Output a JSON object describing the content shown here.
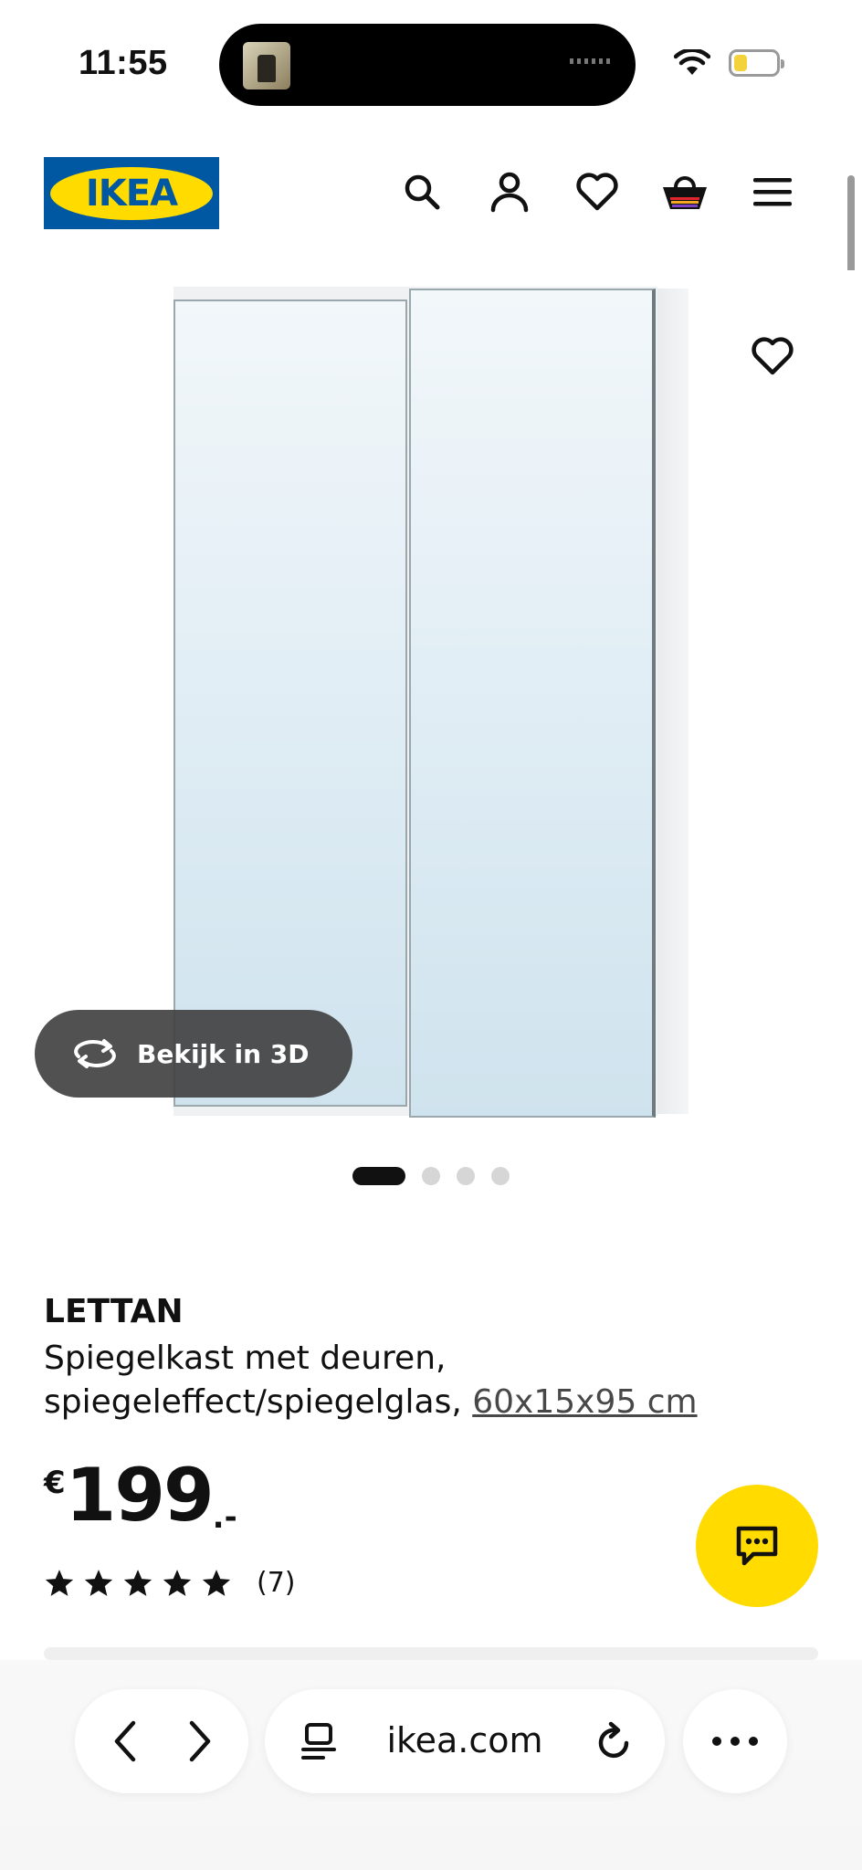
{
  "status_bar": {
    "time": "11:55"
  },
  "header": {
    "logo_text": "IKEA",
    "icons": [
      "search-icon",
      "user-icon",
      "heart-icon",
      "basket-icon",
      "menu-icon"
    ]
  },
  "gallery": {
    "view_3d_label": "Bekijk in 3D",
    "image_count": 4,
    "active_index": 0
  },
  "product": {
    "name": "LETTAN",
    "description": "Spiegelkast met deuren, spiegeleffect/spiegelglas,",
    "size": "60x15x95 cm",
    "price_currency": "€",
    "price_value": "199",
    "price_decimals": ".-",
    "rating_stars": 5,
    "rating_count": "(7)"
  },
  "browser": {
    "url": "ikea.com"
  },
  "colors": {
    "ikea_blue": "#0058a3",
    "ikea_yellow": "#ffdb00",
    "text": "#111111"
  }
}
